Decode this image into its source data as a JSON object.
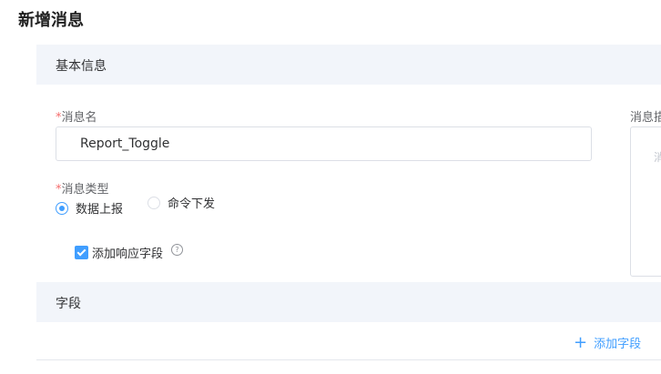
{
  "page": {
    "title": "新增消息"
  },
  "basic_section": {
    "title": "基本信息"
  },
  "message_name": {
    "required_mark": "*",
    "label": "消息名",
    "value": "Report_Toggle"
  },
  "message_desc": {
    "label": "消息描",
    "placeholder": "消"
  },
  "message_type": {
    "required_mark": "*",
    "label": "消息类型",
    "options": [
      {
        "label": "数据上报",
        "selected": true
      },
      {
        "label": "命令下发",
        "selected": false
      }
    ]
  },
  "response_field": {
    "label": "添加响应字段",
    "checked": true,
    "help_icon": "question-circle-icon"
  },
  "fields_section": {
    "title": "字段"
  },
  "add_field": {
    "icon": "plus-icon",
    "label": "添加字段"
  },
  "colors": {
    "accent": "#409eff",
    "section_bg": "#f2f5fa",
    "required": "#f56c6c"
  }
}
